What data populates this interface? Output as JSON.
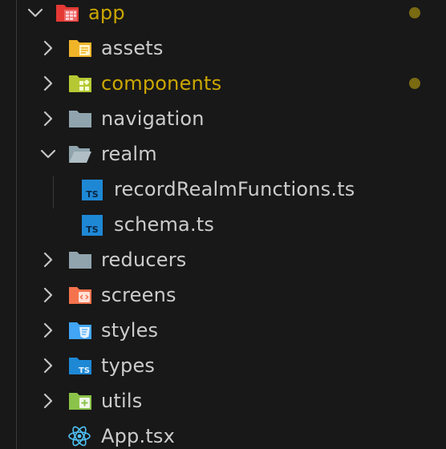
{
  "explorer": {
    "root": {
      "label": "app",
      "expanded": true,
      "modified": true
    },
    "items": [
      {
        "label": "assets",
        "type": "folder",
        "icon": "assets-folder-icon",
        "color": "#f0b429"
      },
      {
        "label": "components",
        "type": "folder",
        "icon": "components-folder-icon",
        "color": "#b5c833",
        "modified": true
      },
      {
        "label": "navigation",
        "type": "folder",
        "icon": "folder-icon",
        "color": "#90a4ae"
      },
      {
        "label": "realm",
        "type": "folder",
        "icon": "folder-open-icon",
        "color": "#90a4ae",
        "expanded": true,
        "children": [
          {
            "label": "recordRealmFunctions.ts",
            "type": "file",
            "icon": "typescript-file-icon",
            "color": "#1e88d5"
          },
          {
            "label": "schema.ts",
            "type": "file",
            "icon": "typescript-file-icon",
            "color": "#1e88d5"
          }
        ]
      },
      {
        "label": "reducers",
        "type": "folder",
        "icon": "folder-icon",
        "color": "#90a4ae"
      },
      {
        "label": "screens",
        "type": "folder",
        "icon": "screens-folder-icon",
        "color": "#f4734d"
      },
      {
        "label": "styles",
        "type": "folder",
        "icon": "styles-folder-icon",
        "color": "#42a5f5"
      },
      {
        "label": "types",
        "type": "folder",
        "icon": "types-folder-icon",
        "color": "#1e88d5"
      },
      {
        "label": "utils",
        "type": "folder",
        "icon": "utils-folder-icon",
        "color": "#8bc34a"
      },
      {
        "label": "App.tsx",
        "type": "file",
        "icon": "react-file-icon",
        "color": "#4fc3f7"
      }
    ],
    "colors": {
      "background": "#181818",
      "text": "#cccccc",
      "modified_text": "#cca700",
      "modified_dot": "#7a6a12",
      "indent_guide": "#3a3a3a"
    }
  }
}
